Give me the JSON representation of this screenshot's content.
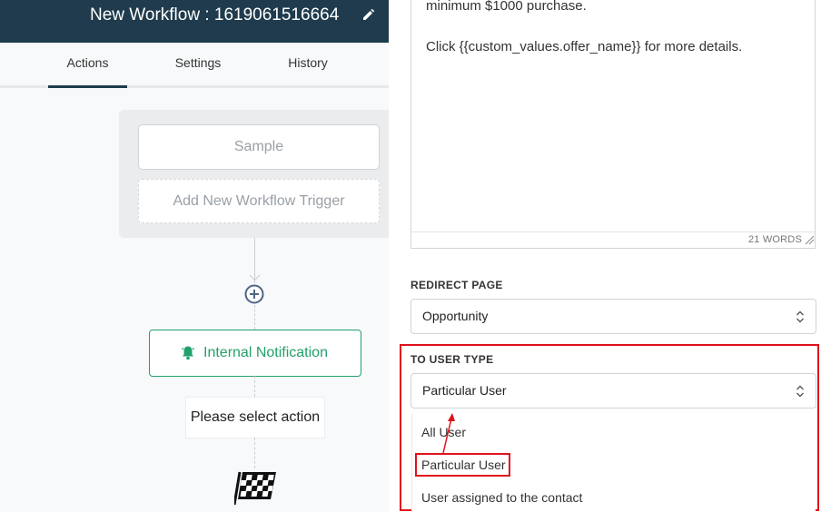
{
  "header": {
    "title": "New Workflow : 1619061516664"
  },
  "tabs": [
    {
      "label": "Actions",
      "active": true
    },
    {
      "label": "Settings",
      "active": false
    },
    {
      "label": "History",
      "active": false
    }
  ],
  "workflow": {
    "trigger_label": "Sample",
    "add_trigger_label": "Add New Workflow Trigger",
    "action_label": "Internal Notification",
    "select_action_label": "Please select action"
  },
  "editor": {
    "line1": "minimum $1000 purchase.",
    "line2": "Click {{custom_values.offer_name}} for more details.",
    "word_count": "21 WORDS"
  },
  "redirect_page": {
    "label": "REDIRECT PAGE",
    "value": "Opportunity"
  },
  "user_type": {
    "label": "TO USER TYPE",
    "value": "Particular User",
    "options": [
      "All User",
      "Particular User",
      "User assigned to the contact"
    ]
  },
  "colors": {
    "header_bg": "#1f3b4d",
    "accent_green": "#22a06b",
    "highlight_red": "#e0121c"
  }
}
